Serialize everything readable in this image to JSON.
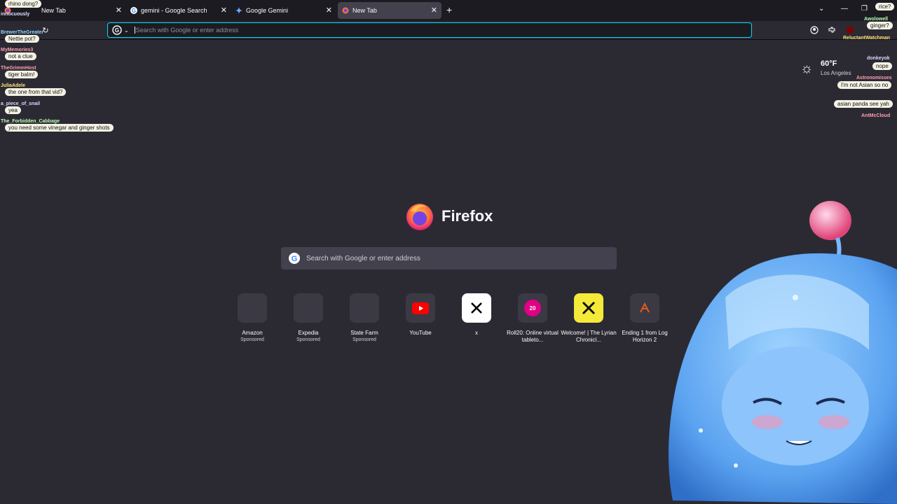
{
  "tabs": [
    {
      "title": "New Tab"
    },
    {
      "title": "gemini - Google Search"
    },
    {
      "title": "Google Gemini"
    },
    {
      "title": "New Tab"
    }
  ],
  "toolbar": {
    "url_placeholder": "Search with Google or enter address"
  },
  "weather": {
    "temp": "60°F",
    "city": "Los Angeles"
  },
  "newtab": {
    "brand": "Firefox",
    "search_placeholder": "Search with Google or enter address",
    "top_sites": [
      {
        "name": "Amazon",
        "sponsored": "Sponsored",
        "icon": "blank-tile"
      },
      {
        "name": "Expedia",
        "sponsored": "Sponsored",
        "icon": "blank-tile"
      },
      {
        "name": "State Farm",
        "sponsored": "Sponsored",
        "icon": "blank-tile"
      },
      {
        "name": "YouTube",
        "sponsored": "",
        "icon": "youtube-icon"
      },
      {
        "name": "x",
        "sponsored": "",
        "icon": "x-icon"
      },
      {
        "name": "Roll20: Online virtual tableto...",
        "sponsored": "",
        "icon": "roll20-icon"
      },
      {
        "name": "Welcome! | The Lyrian Chronicl...",
        "sponsored": "",
        "icon": "lyrian-icon"
      },
      {
        "name": "Ending 1 from Log Horizon 2",
        "sponsored": "",
        "icon": "loghorizon-icon"
      }
    ]
  },
  "chat_left": [
    {
      "user": "",
      "msg": "rhino dong?"
    },
    {
      "user": "innocuously",
      "msg": ""
    },
    {
      "user": "BrewerTheGreater",
      "msg": "Nettie pot?"
    },
    {
      "user": "MyMemories3",
      "msg": "not a clue"
    },
    {
      "user": "TheGrimmHost",
      "msg": "tiger balm!"
    },
    {
      "user": "JuliaAdele",
      "msg": "the one from that vid?"
    },
    {
      "user": "a_piece_of_snail",
      "msg": "yea"
    },
    {
      "user": "The_Forbidden_Cabbage",
      "msg": "you need some vinegar and ginger shots"
    }
  ],
  "chat_right": [
    {
      "user": "",
      "msg": "rice?"
    },
    {
      "user": "Awolowell",
      "msg": "ginger?"
    },
    {
      "user": "ReluctantWatchman",
      "msg": ""
    },
    {
      "user": "donkeyok",
      "msg": "nope"
    },
    {
      "user": "Astronomisses",
      "msg": "I'm not Asian so no"
    },
    {
      "user": "",
      "msg": "asian panda see yah"
    },
    {
      "user": "AntMcCloud",
      "msg": ""
    }
  ],
  "colors": {
    "accent": "#00ddff",
    "bg": "#2b2a33",
    "tab_bar": "#1c1b22"
  }
}
